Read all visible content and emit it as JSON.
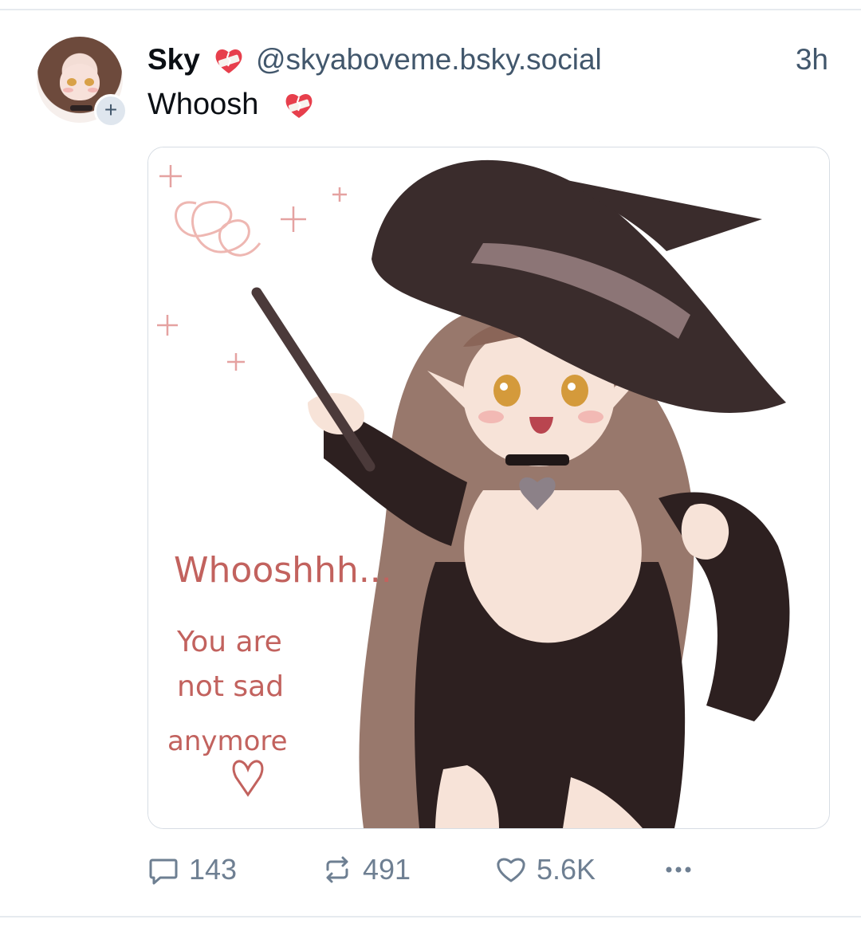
{
  "post": {
    "author": {
      "display_name": "Sky",
      "handle": "@skyaboveme.bsky.social"
    },
    "timestamp": "3h",
    "text": "Whoosh",
    "image": {
      "handwritten_lines": [
        "Whooshhh...",
        "You are",
        "not sad",
        "anymore"
      ]
    },
    "counts": {
      "replies": "143",
      "reposts": "491",
      "likes": "5.6K"
    }
  },
  "icons": {
    "avatar_badge": "plus-icon",
    "emoji": "mending-heart-icon",
    "reply": "speech-bubble-icon",
    "repost": "repost-arrows-icon",
    "like": "heart-outline-icon",
    "more": "ellipsis-icon"
  },
  "colors": {
    "muted": "#42576c",
    "action": "#6e7f92",
    "ink": "#0b0f14"
  }
}
